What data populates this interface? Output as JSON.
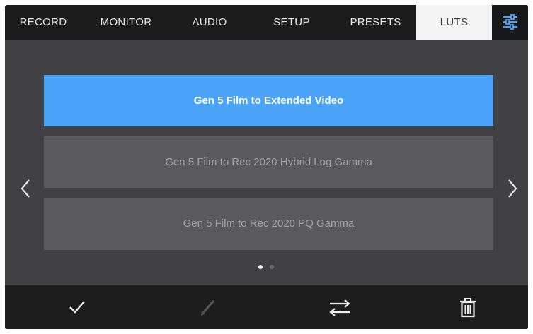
{
  "tabs": [
    {
      "label": "RECORD",
      "active": false
    },
    {
      "label": "MONITOR",
      "active": false
    },
    {
      "label": "AUDIO",
      "active": false
    },
    {
      "label": "SETUP",
      "active": false
    },
    {
      "label": "PRESETS",
      "active": false
    },
    {
      "label": "LUTS",
      "active": true
    }
  ],
  "settings_icon": "sliders-icon",
  "luts": [
    {
      "label": "Gen 5 Film to Extended Video",
      "selected": true
    },
    {
      "label": "Gen 5 Film to Rec 2020 Hybrid Log Gamma",
      "selected": false
    },
    {
      "label": "Gen 5 Film to Rec 2020 PQ Gamma",
      "selected": false
    }
  ],
  "pagination": {
    "current": 1,
    "total": 2
  },
  "toolbar": {
    "icons": [
      "checkmark-icon",
      "pencil-icon",
      "swap-arrows-icon",
      "trash-icon"
    ],
    "disabled": [
      "pencil-icon"
    ]
  },
  "colors": {
    "selected": "#4aa3f7",
    "background": "#414143",
    "bar": "#1b1b1c",
    "item": "#5a5a5c"
  }
}
